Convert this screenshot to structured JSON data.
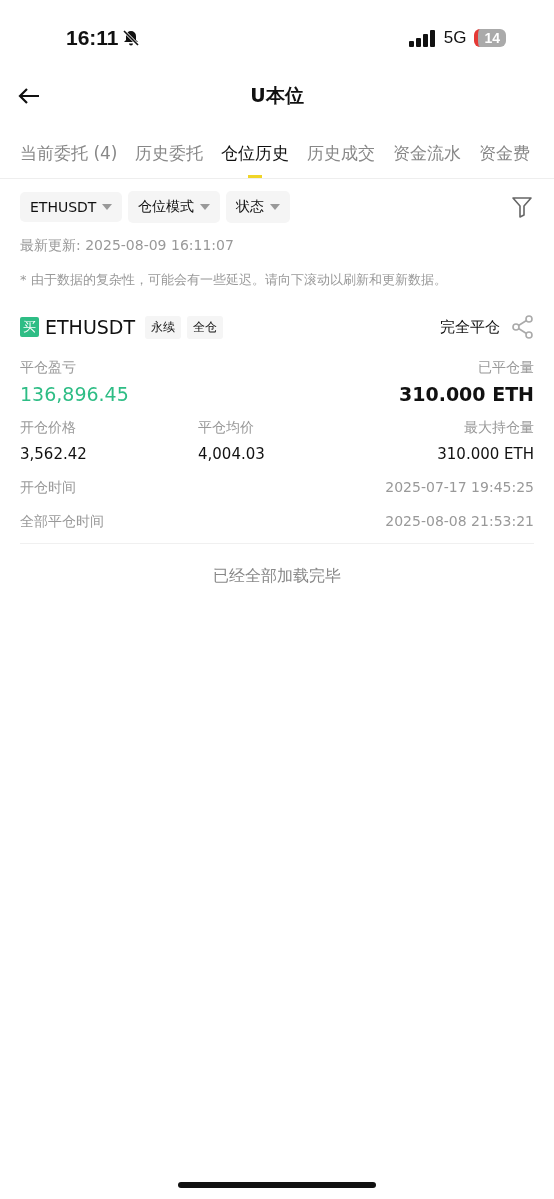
{
  "status_bar": {
    "time": "16:11",
    "network": "5G",
    "battery": "14"
  },
  "header": {
    "title": "U本位"
  },
  "tabs": [
    {
      "label": "当前委托 (4)",
      "selected": false
    },
    {
      "label": "历史委托",
      "selected": false
    },
    {
      "label": "仓位历史",
      "selected": true
    },
    {
      "label": "历史成交",
      "selected": false
    },
    {
      "label": "资金流水",
      "selected": false
    },
    {
      "label": "资金费",
      "selected": false
    }
  ],
  "filters": [
    {
      "label": "ETHUSDT"
    },
    {
      "label": "仓位模式"
    },
    {
      "label": "状态"
    }
  ],
  "last_update": "最新更新: 2025-08-09 16:11:07",
  "notice": "* 由于数据的复杂性，可能会有一些延迟。请向下滚动以刷新和更新数据。",
  "position": {
    "side": "买",
    "symbol": "ETHUSDT",
    "tags": [
      "永续",
      "全仓"
    ],
    "status": "完全平仓",
    "pnl_label": "平仓盈亏",
    "pnl": "136,896.45",
    "closed_label": "已平仓量",
    "closed": "310.000 ETH",
    "stats": [
      {
        "label": "开仓价格",
        "value": "3,562.42"
      },
      {
        "label": "平仓均价",
        "value": "4,004.03"
      },
      {
        "label": "最大持仓量",
        "value": "310.000 ETH"
      }
    ],
    "times": [
      {
        "label": "开仓时间",
        "value": "2025-07-17 19:45:25"
      },
      {
        "label": "全部平仓时间",
        "value": "2025-08-08 21:53:21"
      }
    ]
  },
  "footer": "已经全部加载完毕"
}
